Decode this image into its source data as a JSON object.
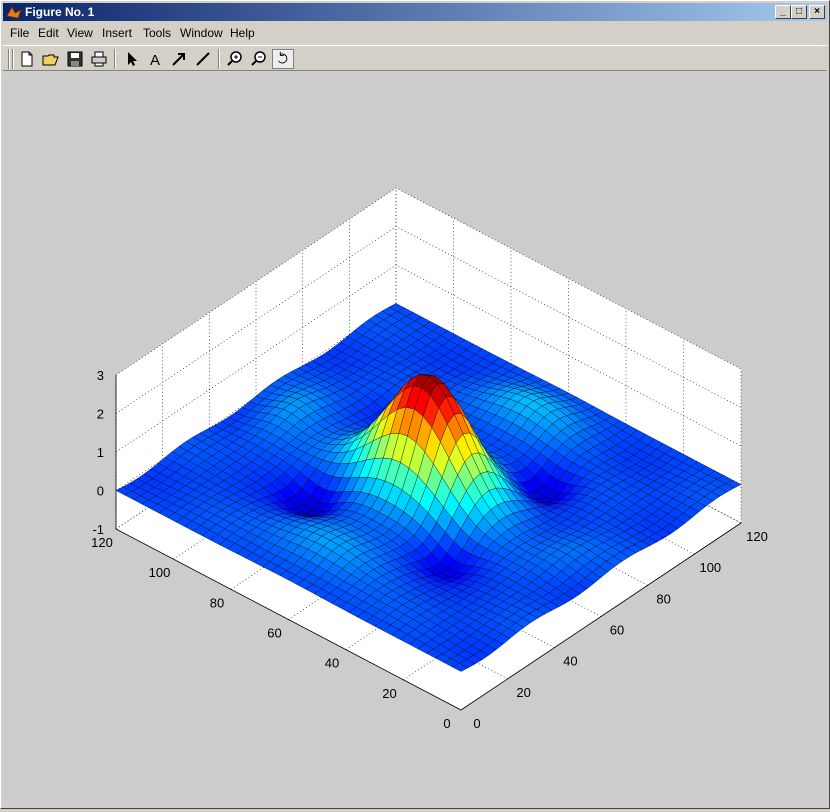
{
  "window": {
    "title": "Figure No. 1"
  },
  "menu": [
    "File",
    "Edit",
    "View",
    "Insert",
    "Tools",
    "Window",
    "Help"
  ],
  "toolbar": {
    "icons": [
      "new-file-icon",
      "open-folder-icon",
      "save-icon",
      "print-icon",
      "pointer-icon",
      "text-icon",
      "arrow-icon",
      "line-icon",
      "zoom-in-icon",
      "zoom-out-icon",
      "rotate-3d-icon"
    ]
  },
  "colors": {
    "figure_bg": "#cccccc",
    "axes_bg": "#ffffff",
    "mesh_grid": "#3355cc"
  },
  "chart_data": {
    "type": "surface",
    "title": "",
    "xlabel": "",
    "ylabel": "",
    "zlabel": "",
    "xlim": [
      0,
      120
    ],
    "ylim": [
      0,
      120
    ],
    "zlim": [
      -1,
      3
    ],
    "x_ticks": [
      "0",
      "20",
      "40",
      "60",
      "80",
      "100",
      "120"
    ],
    "y_ticks": [
      "0",
      "20",
      "40",
      "60",
      "80",
      "100",
      "120"
    ],
    "z_ticks": [
      "-1",
      "0",
      "1",
      "2",
      "3"
    ],
    "grid": true,
    "colormap": "jet",
    "peak_height": 2.9
  }
}
